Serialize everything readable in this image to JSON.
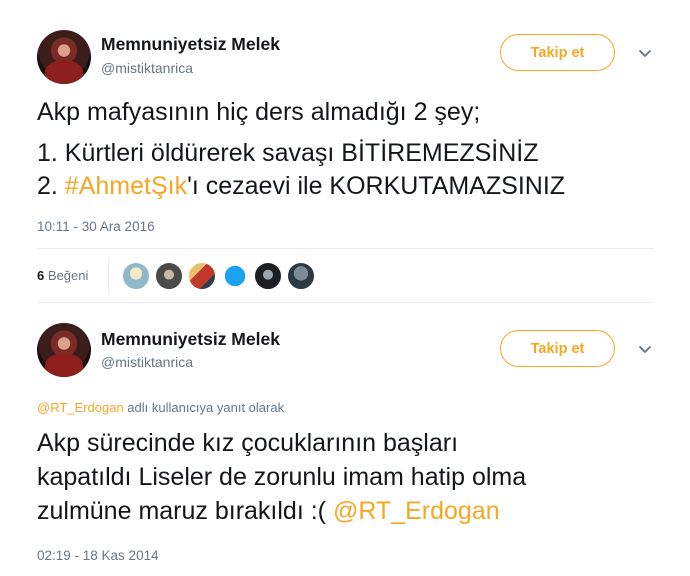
{
  "tweets": [
    {
      "author_name": "Memnuniyetsiz Melek",
      "author_handle": "@mistiktanrica",
      "follow_label": "Takip et",
      "lines": [
        {
          "text": "Akp mafyasının hiç ders almadığı 2 şey;"
        },
        {
          "text": "1. Kürtleri öldürerek savaşı BİTİREMEZSİNİZ"
        },
        {
          "prefix": "2. ",
          "hashtag": "#AhmetŞık",
          "suffix": "'ı cezaevi ile KORKUTAMAZSINIZ"
        }
      ],
      "timestamp": "10:11 - 30 Ara 2016",
      "likes_count": "6",
      "likes_label": "Beğeni",
      "liker_avatars": [
        "liker-1",
        "liker-2",
        "liker-3",
        "liker-4",
        "liker-5",
        "liker-6"
      ]
    },
    {
      "author_name": "Memnuniyetsiz Melek",
      "author_handle": "@mistiktanrica",
      "follow_label": "Takip et",
      "reply_mention": "@RT_Erdogan",
      "reply_text": " adlı kullanıcıya yanıt olarak",
      "lines": [
        {
          "text": "Akp sürecinde kız çocuklarının başları"
        },
        {
          "text": "kapatıldı Liseler de zorunlu imam hatip olma"
        },
        {
          "prefix": "zulmüne maruz bırakıldı :( ",
          "mention": "@RT_Erdogan"
        }
      ],
      "timestamp": "02:19 - 18 Kas 2014"
    }
  ],
  "colors": {
    "accent": "#f5a623",
    "text": "#14171a",
    "muted": "#657786",
    "divider": "#e6ecf0"
  },
  "icons": {
    "more": "chevron-down-icon"
  }
}
